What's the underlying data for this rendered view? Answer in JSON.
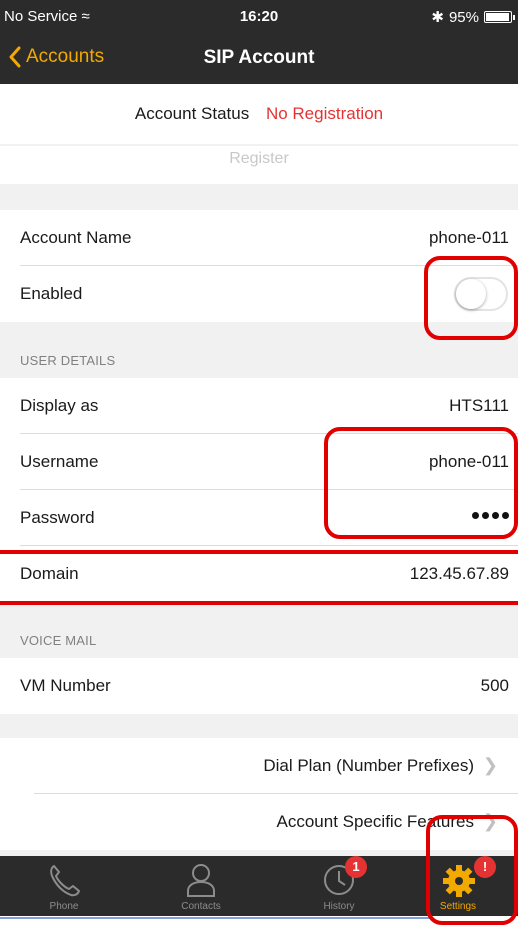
{
  "statusbar": {
    "carrier": "No Service",
    "time": "16:20",
    "battery": "95%"
  },
  "nav": {
    "back_label": "Accounts",
    "title": "SIP Account"
  },
  "account_status": {
    "label": "Account Status",
    "value": "No Registration",
    "register_label": "Register"
  },
  "general": {
    "account_name_label": "Account Name",
    "account_name_value": "phone-011",
    "enabled_label": "Enabled",
    "enabled": false
  },
  "user_details": {
    "header": "USER DETAILS",
    "display_label": "Display as",
    "display_value": "HTS111",
    "username_label": "Username",
    "username_value": "phone-011",
    "password_label": "Password",
    "domain_label": "Domain",
    "domain_value": "123.45.67.89"
  },
  "voice_mail": {
    "header": "VOICE MAIL",
    "vm_label": "VM Number",
    "vm_value": "500"
  },
  "links": {
    "dial_plan": "Dial Plan (Number Prefixes)",
    "account_features": "Account Specific Features"
  },
  "tabs": [
    {
      "label": "Phone",
      "icon": "phone-icon"
    },
    {
      "label": "Contacts",
      "icon": "contacts-icon"
    },
    {
      "label": "History",
      "icon": "history-icon",
      "badge": "1"
    },
    {
      "label": "Settings",
      "icon": "gear-icon",
      "badge": "!"
    }
  ],
  "colors": {
    "accent": "#f2a900",
    "error": "#e53333",
    "bar": "#2b2b2b",
    "highlight": "#e00000"
  }
}
